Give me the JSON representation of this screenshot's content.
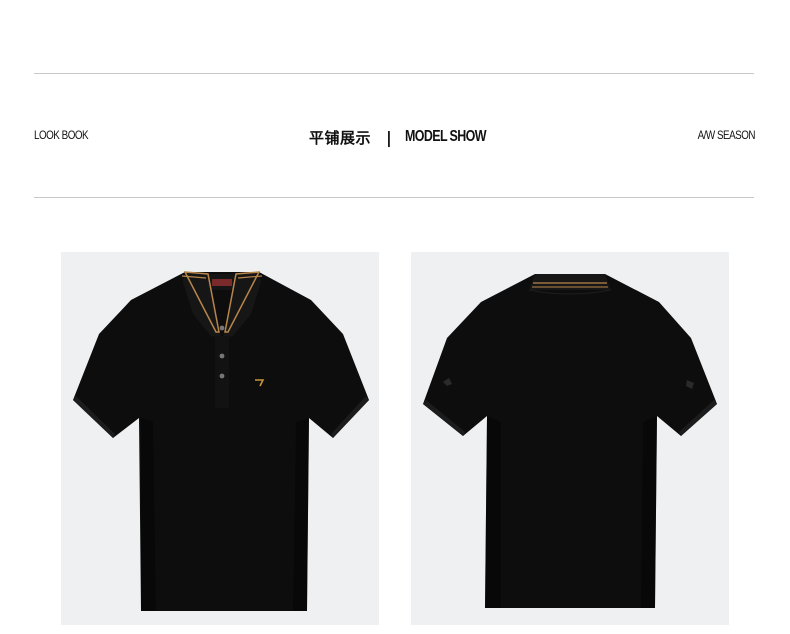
{
  "header": {
    "left_label": "LOOK BOOK",
    "center_cn": "平铺展示",
    "center_separator": "|",
    "center_en": "MODEL SHOW",
    "right_label": "A/W SEASON"
  },
  "products": [
    {
      "view": "front",
      "shirt_color": "#0c0c0c",
      "collar_stripe_color": "#b8864a",
      "background": "#eff0f2"
    },
    {
      "view": "back",
      "shirt_color": "#0c0c0c",
      "collar_stripe_color": "#b8864a",
      "background": "#eff0f2"
    }
  ]
}
